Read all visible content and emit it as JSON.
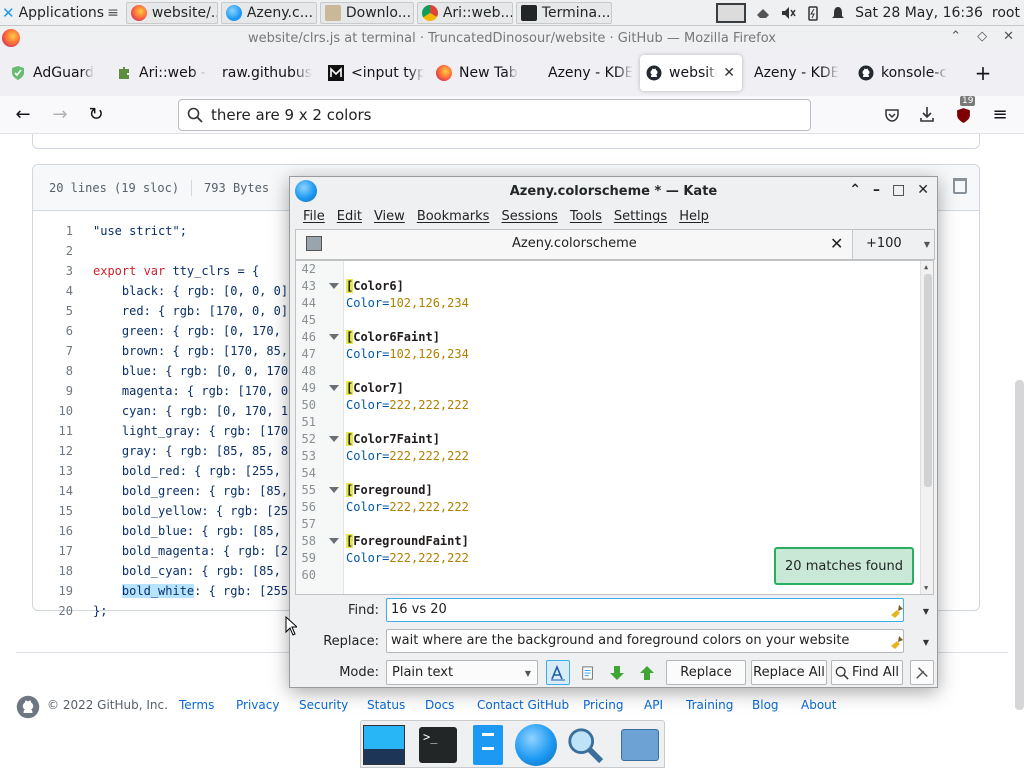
{
  "panel": {
    "apps_label": "Applications",
    "tasks": [
      {
        "label": "website/...",
        "icon": "firefox-icon"
      },
      {
        "label": "Azeny.c...",
        "icon": "kate-icon"
      },
      {
        "label": "Downlo...",
        "icon": "folder-icon"
      },
      {
        "label": "Ari::web...",
        "icon": "chrome-icon"
      },
      {
        "label": "Termina...",
        "icon": "terminal-icon"
      }
    ],
    "clock": "Sat 28 May, 16:36",
    "user": "root"
  },
  "firefox": {
    "window_title": "website/clrs.js at terminal · TruncatedDinosour/website · GitHub — Mozilla Firefox",
    "tabs": [
      {
        "label": "AdGuard",
        "icon": "shield-icon"
      },
      {
        "label": "Ari::web -",
        "icon": "puzzle-icon"
      },
      {
        "label": "raw.githubus",
        "icon": "blank-icon"
      },
      {
        "label": "<input typ",
        "icon": "mdn-icon"
      },
      {
        "label": "New Tab",
        "icon": "firefox-icon"
      },
      {
        "label": "Azeny - KDE",
        "icon": "blank-icon"
      },
      {
        "label": "website",
        "icon": "github-icon",
        "active": true
      },
      {
        "label": "Azeny - KDE",
        "icon": "blank-icon"
      },
      {
        "label": "konsole-c",
        "icon": "github-icon"
      }
    ],
    "url": "there are 9 x 2 colors",
    "ublock_badge": "19"
  },
  "github": {
    "file_lines": "20 lines (19 sloc)",
    "file_size": "793 Bytes",
    "code": [
      {
        "n": "1",
        "text": "\"use strict\";"
      },
      {
        "n": "2",
        "text": ""
      },
      {
        "n": "3",
        "kw": "export var",
        "text": " tty_clrs = {"
      },
      {
        "n": "4",
        "text": "    black: { rgb: [0, 0, 0]"
      },
      {
        "n": "5",
        "text": "    red: { rgb: [170, 0, 0]"
      },
      {
        "n": "6",
        "text": "    green: { rgb: [0, 170, 0"
      },
      {
        "n": "7",
        "text": "    brown: { rgb: [170, 85,"
      },
      {
        "n": "8",
        "text": "    blue: { rgb: [0, 0, 170"
      },
      {
        "n": "9",
        "text": "    magenta: { rgb: [170, 0"
      },
      {
        "n": "10",
        "text": "    cyan: { rgb: [0, 170, 1"
      },
      {
        "n": "11",
        "text": "    light_gray: { rgb: [170"
      },
      {
        "n": "12",
        "text": "    gray: { rgb: [85, 85, 8"
      },
      {
        "n": "13",
        "text": "    bold_red: { rgb: [255, 8"
      },
      {
        "n": "14",
        "text": "    bold_green: { rgb: [85,"
      },
      {
        "n": "15",
        "text": "    bold_yellow: { rgb: [255"
      },
      {
        "n": "16",
        "text": "    bold_blue: { rgb: [85, 8"
      },
      {
        "n": "17",
        "text": "    bold_magenta: { rgb: [25"
      },
      {
        "n": "18",
        "text": "    bold_cyan: { rgb: [85, 2"
      },
      {
        "n": "19",
        "sel": "bold_white",
        "text": ": { rgb: [255"
      },
      {
        "n": "20",
        "text": "};"
      }
    ],
    "footer": {
      "copyright": "© 2022 GitHub, Inc.",
      "links": [
        "Terms",
        "Privacy",
        "Security",
        "Status",
        "Docs",
        "Contact GitHub",
        "Pricing",
        "API",
        "Training",
        "Blog",
        "About"
      ]
    }
  },
  "kate": {
    "title": "Azeny.colorscheme * — Kate",
    "menu": [
      "File",
      "Edit",
      "View",
      "Bookmarks",
      "Sessions",
      "Tools",
      "Settings",
      "Help"
    ],
    "doc_tab": "Azeny.colorscheme",
    "more_tabs": "+100",
    "lines": [
      {
        "n": "42",
        "t": ""
      },
      {
        "n": "43",
        "section": "Color6]",
        "fold": true
      },
      {
        "n": "44",
        "key": "Color=",
        "val": "102,126,234"
      },
      {
        "n": "45",
        "t": ""
      },
      {
        "n": "46",
        "section": "Color6Faint]",
        "fold": true
      },
      {
        "n": "47",
        "key": "Color=",
        "val": "102,126,234"
      },
      {
        "n": "48",
        "t": ""
      },
      {
        "n": "49",
        "section": "Color7]",
        "fold": true
      },
      {
        "n": "50",
        "key": "Color=",
        "val": "222,222,222"
      },
      {
        "n": "51",
        "t": ""
      },
      {
        "n": "52",
        "section": "Color7Faint]",
        "fold": true
      },
      {
        "n": "53",
        "key": "Color=",
        "val": "222,222,222"
      },
      {
        "n": "54",
        "t": ""
      },
      {
        "n": "55",
        "section": "Foreground]",
        "fold": true
      },
      {
        "n": "56",
        "key": "Color=",
        "val": "222,222,222"
      },
      {
        "n": "57",
        "t": ""
      },
      {
        "n": "58",
        "section": "ForegroundFaint]",
        "fold": true
      },
      {
        "n": "59",
        "key": "Color=",
        "val": "222,222,222"
      },
      {
        "n": "60",
        "t": ""
      }
    ],
    "matches_toast": "20 matches found",
    "find": {
      "label": "Find:",
      "value": "16 vs 20"
    },
    "replace": {
      "label": "Replace:",
      "value": "wait where are the background and foreground colors on your website"
    },
    "mode": {
      "label": "Mode:",
      "value": "Plain text"
    },
    "buttons": {
      "replace": "Replace",
      "replace_all": "Replace All",
      "find_all": "Find All"
    }
  },
  "colors": {
    "accent": "#3daee9",
    "toast_border": "#27ae60",
    "highlight": "#e7e84a"
  }
}
